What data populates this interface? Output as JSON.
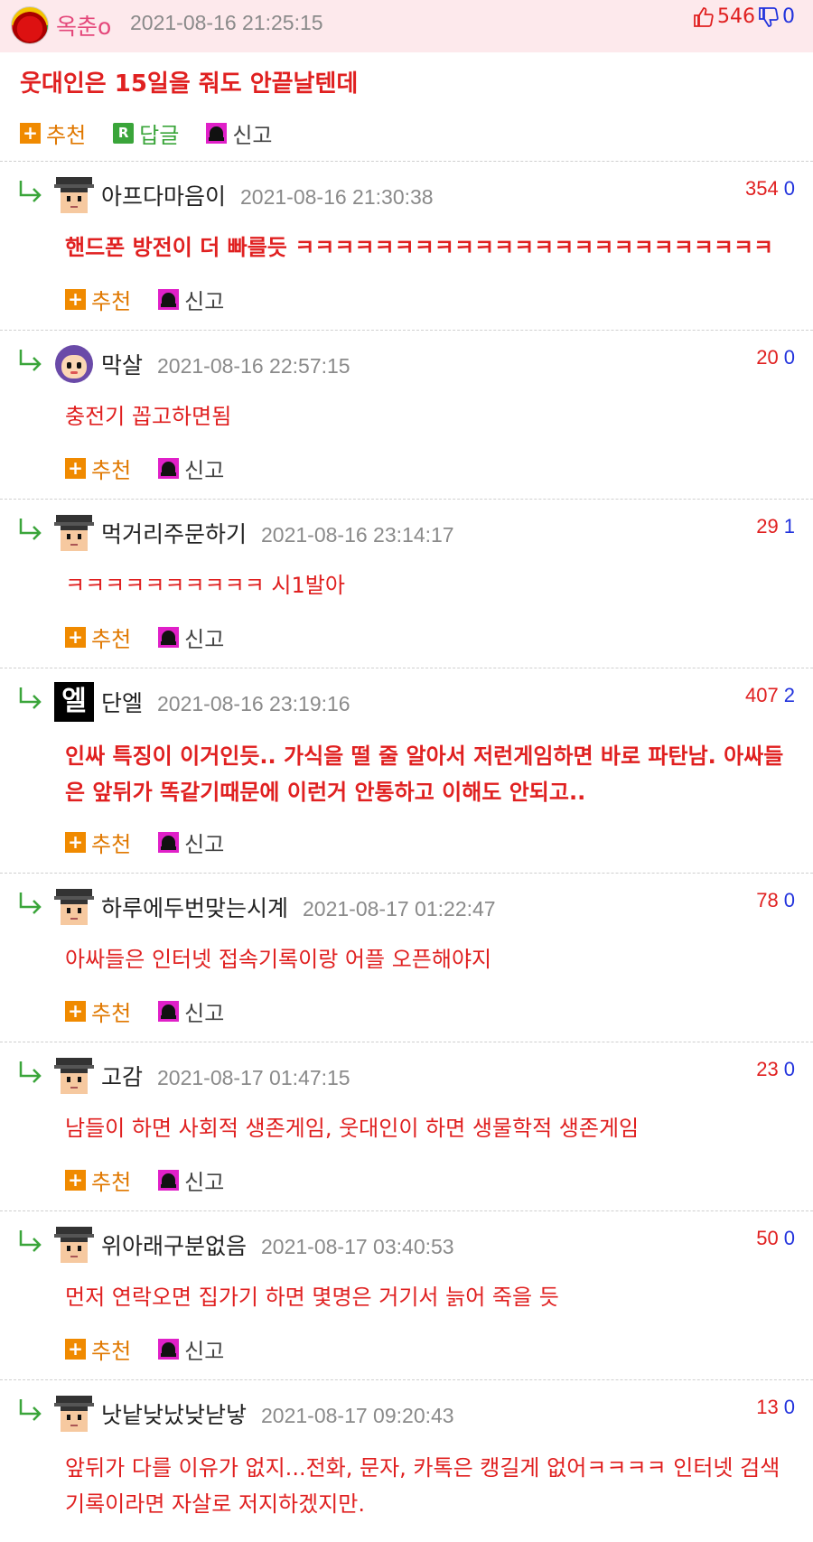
{
  "post": {
    "author": "옥춘o",
    "date": "2021-08-16 21:25:15",
    "up": "546",
    "down": "0",
    "title": "웃대인은 15일을 줘도 안끝날텐데",
    "actions": {
      "recommend": "추천",
      "reply": "답글",
      "report": "신고"
    }
  },
  "labels": {
    "recommend": "추천",
    "report": "신고"
  },
  "comments": [
    {
      "author": "아프다마음이",
      "date": "2021-08-16 21:30:38",
      "up": "354",
      "down": "0",
      "text": "핸드폰 방전이 더 빠를듯 ㅋㅋㅋㅋㅋㅋㅋㅋㅋㅋㅋㅋㅋㅋㅋㅋㅋㅋㅋㅋㅋㅋㅋㅋ",
      "bold": true
    },
    {
      "author": "막살",
      "date": "2021-08-16 22:57:15",
      "up": "20",
      "down": "0",
      "text": "충전기 꼽고하면됨",
      "bold": false
    },
    {
      "author": "먹거리주문하기",
      "date": "2021-08-16 23:14:17",
      "up": "29",
      "down": "1",
      "text": "ㅋㅋㅋㅋㅋㅋㅋㅋㅋㅋ 시1발아",
      "bold": false
    },
    {
      "author": "단엘",
      "date": "2021-08-16 23:19:16",
      "up": "407",
      "down": "2",
      "text": "인싸 특징이 이거인듯.. 가식을 떨 줄 알아서 저런게임하면 바로 파탄남. 아싸들은 앞뒤가 똑같기때문에 이런거 안통하고 이해도 안되고..",
      "bold": true
    },
    {
      "author": "하루에두번맞는시계",
      "date": "2021-08-17 01:22:47",
      "up": "78",
      "down": "0",
      "text": "아싸들은 인터넷 접속기록이랑 어플 오픈해야지",
      "bold": false
    },
    {
      "author": "고감",
      "date": "2021-08-17 01:47:15",
      "up": "23",
      "down": "0",
      "text": "남들이 하면 사회적 생존게임, 웃대인이 하면 생물학적 생존게임",
      "bold": false
    },
    {
      "author": "위아래구분없음",
      "date": "2021-08-17 03:40:53",
      "up": "50",
      "down": "0",
      "text": "먼저 연락오면 집가기 하면 몇명은 거기서 늙어 죽을 듯",
      "bold": false
    },
    {
      "author": "낫낱낮났낮낟낳",
      "date": "2021-08-17 09:20:43",
      "up": "13",
      "down": "0",
      "text": "앞뒤가 다를 이유가 없지...전화, 문자, 카톡은 캥길게 없어ㅋㅋㅋㅋ 인터넷 검색 기록이라면 자살로 저지하겠지만.",
      "bold": false
    }
  ],
  "avatars": {
    "c4": "엘"
  },
  "colors": {
    "header_bg": "#fde9ec",
    "accent_red": "#e02020",
    "down_blue": "#2233dd",
    "recommend_orange": "#e07800"
  }
}
